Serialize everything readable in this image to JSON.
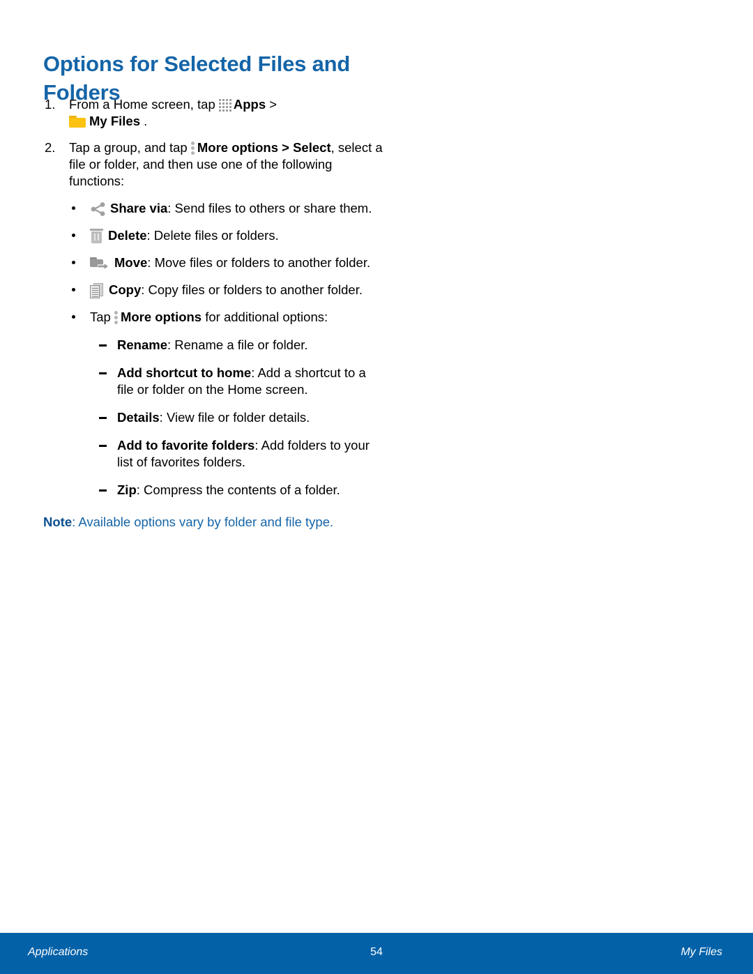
{
  "document": {
    "heading": "Options for Selected Files and Folders",
    "accent_color": "#1565a8",
    "footer_color": "#0361a8",
    "steps": [
      {
        "number": "1.",
        "text_before_apps": "From a Home screen, tap ",
        "apps_label": "Apps",
        "separator": " > ",
        "my_files_label": "My Files",
        "text_after": " ."
      },
      {
        "number": "2.",
        "text_before_more": "Tap a group, and tap ",
        "more_options_label": "More options",
        "arrow": " > ",
        "select_label": "Select",
        "text_after": ", select a file or folder, and then use one of the following functions:"
      }
    ],
    "bullets": [
      {
        "icon": "share-icon",
        "term": "Share via",
        "desc": ": Send files to others or share them."
      },
      {
        "icon": "trash-icon",
        "term": "Delete",
        "desc": ": Delete files or folders."
      },
      {
        "icon": "move-folder-icon",
        "term": "Move",
        "desc": ": Move files or folders to another folder."
      },
      {
        "icon": "copy-icon",
        "term": "Copy",
        "desc": ": Copy files or folders to another folder."
      }
    ],
    "more_options_bullet": {
      "icon": "more-options-icon",
      "text_before": "Tap ",
      "term": "More options",
      "text_after": " for additional options:"
    },
    "sub_items": [
      {
        "term": "Rename",
        "desc": ": Rename a file or folder."
      },
      {
        "term": "Add shortcut to home",
        "desc": ": Add a shortcut to a file or folder on the Home screen."
      },
      {
        "term": "Details",
        "desc": ": View file or folder details."
      },
      {
        "term": "Add to favorite folders",
        "desc": ": Add folders to your list of favorites folders."
      },
      {
        "term": "Zip",
        "desc": ": Compress the contents of a folder."
      }
    ],
    "note": {
      "label": "Note",
      "text": ": Available options vary by folder and file type."
    },
    "footer": {
      "left": "Applications",
      "center": "54",
      "right": "My Files"
    }
  }
}
